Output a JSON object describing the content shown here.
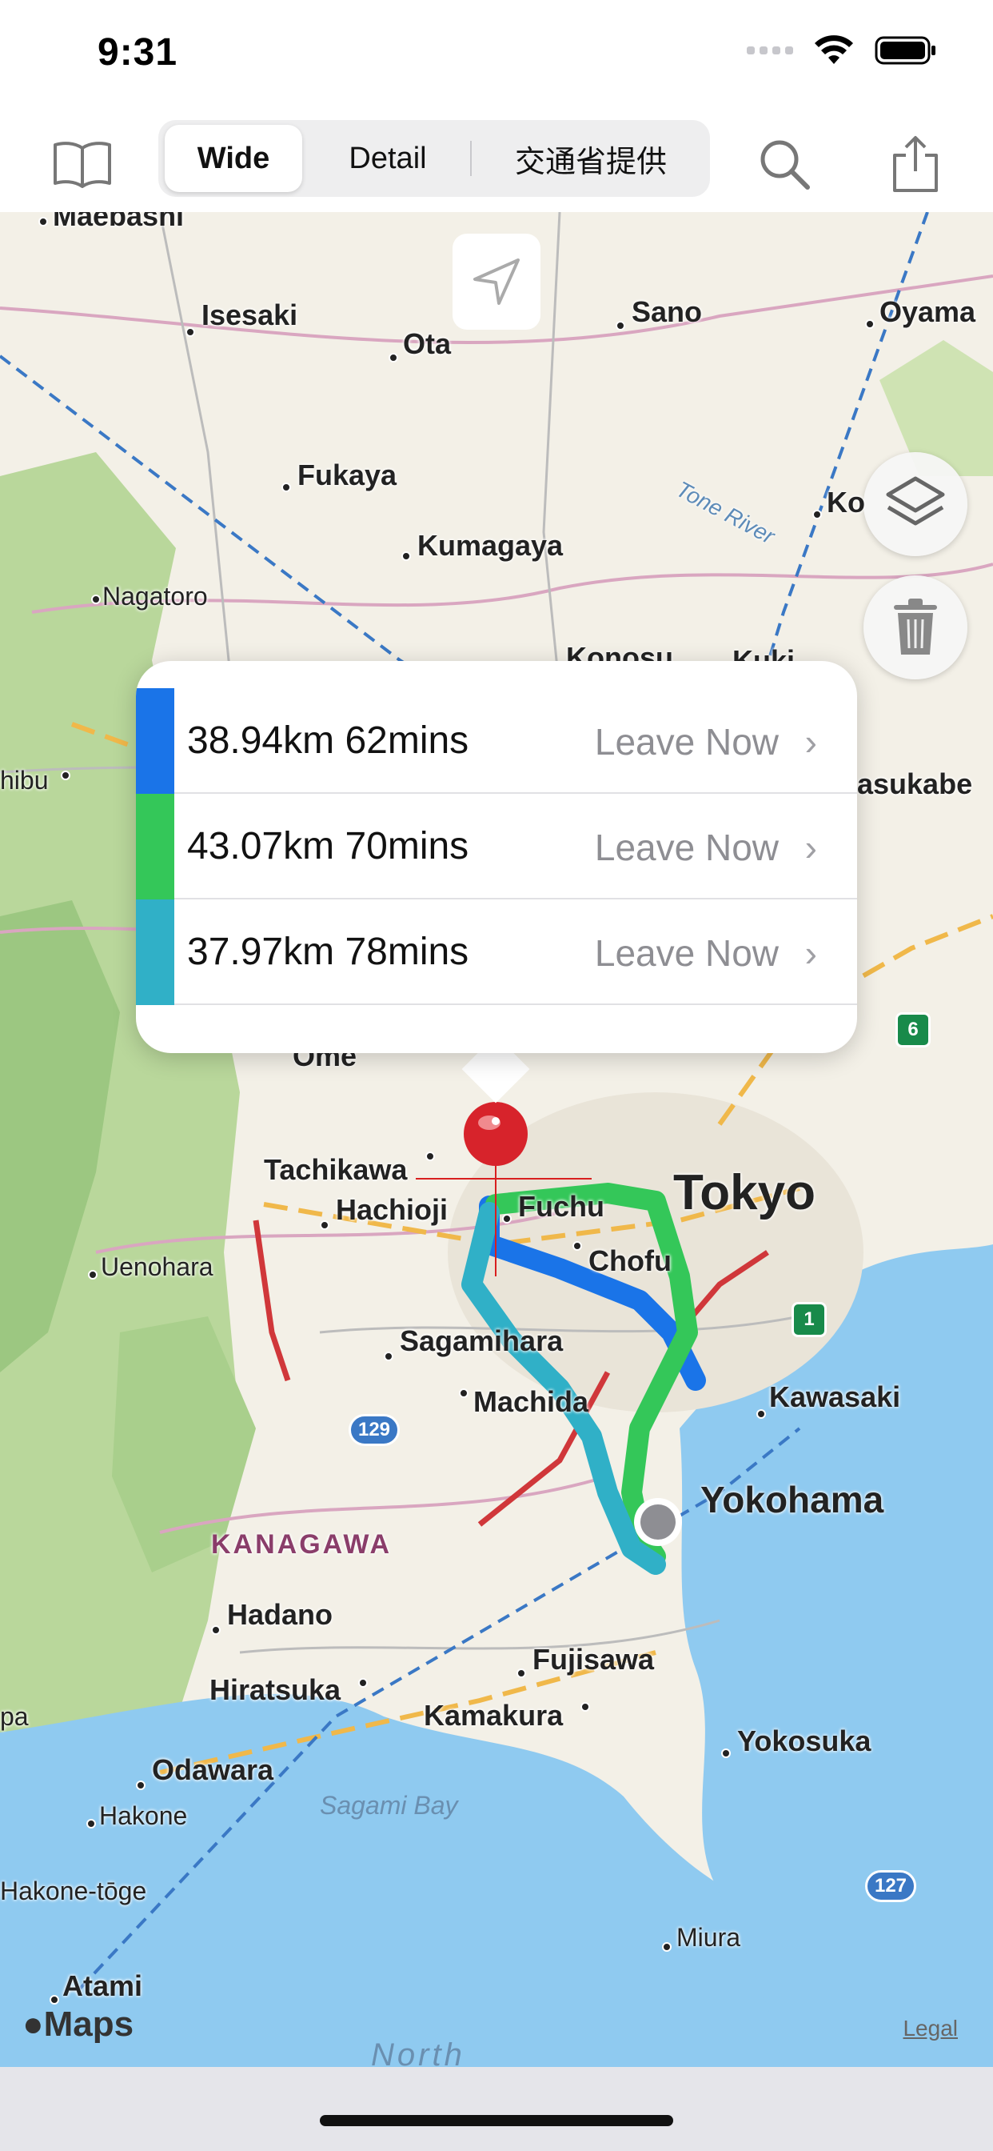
{
  "status_bar": {
    "time": "9:31",
    "icons": [
      "signal-icon",
      "wifi-icon",
      "battery-icon"
    ]
  },
  "toolbar": {
    "bookmarks_icon": "book-icon",
    "segments": [
      "Wide",
      "Detail",
      "交通省提供"
    ],
    "selected_segment": "Wide",
    "search_icon": "search-icon",
    "share_icon": "share-icon"
  },
  "map": {
    "labels": {
      "maebashi": "Maebashi",
      "isesaki": "Isesaki",
      "ota": "Ota",
      "sano": "Sano",
      "oyama": "Oyama",
      "fukaya": "Fukaya",
      "ko": "Ko",
      "kumagaya": "Kumagaya",
      "tone_river": "Tone River",
      "nagatoro": "Nagatoro",
      "konosu": "Konosu",
      "kuki": "Kuki",
      "chichibu": "hibu",
      "kasukabe": "asukabe",
      "ome": "Ome",
      "tachikawa": "Tachikawa",
      "hachioji": "Hachioji",
      "fuchu": "Fuchu",
      "tokyo": "Tokyo",
      "chofu": "Chofu",
      "uenohara": "Uenohara",
      "sagamihara": "Sagamihara",
      "machida": "Machida",
      "kawasaki": "Kawasaki",
      "yokohama": "Yokohama",
      "kanagawa": "KANAGAWA",
      "hadano": "Hadano",
      "hiratsuka": "Hiratsuka",
      "fujisawa": "Fujisawa",
      "kamakura": "Kamakura",
      "yokosuka": "Yokosuka",
      "odawara": "Odawara",
      "hakone": "Hakone",
      "hakone_toge": "Hakone-tōge",
      "sagami_bay": "Sagami Bay",
      "miura": "Miura",
      "atami": "Atami",
      "north": "North",
      "pa": "pa"
    },
    "shields": {
      "r129": "129",
      "r127": "127",
      "e6": "6",
      "e1": "1"
    },
    "layers_icon": "layers-icon",
    "trash_icon": "trash-icon",
    "locate_icon": "location-arrow-icon",
    "pin_icon": "map-pin-icon",
    "start_marker": "start-point-marker",
    "maps_logo": "Maps",
    "legal": "Legal"
  },
  "routes": [
    {
      "summary": "38.94km 62mins",
      "action": "Leave Now",
      "color": "#1a74e8"
    },
    {
      "summary": "43.07km 70mins",
      "action": "Leave Now",
      "color": "#34c759"
    },
    {
      "summary": "37.97km 78mins",
      "action": "Leave Now",
      "color": "#30b0c7"
    }
  ],
  "colors": {
    "accent": "#007aff",
    "water": "#8cc8f0",
    "forest": "#b8d89a"
  }
}
